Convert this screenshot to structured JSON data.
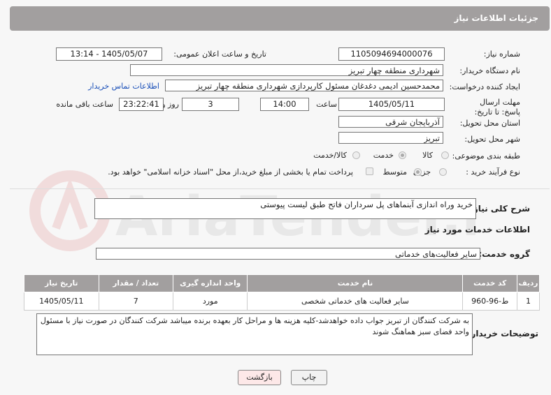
{
  "header": {
    "title": "جزئیات اطلاعات نیاز"
  },
  "fields": {
    "need_number_label": "شماره نیاز:",
    "need_number": "1105094694000076",
    "announce_label": "تاریخ و ساعت اعلان عمومی:",
    "announce_value": "1405/05/07 - 13:14",
    "buyer_org_label": "نام دستگاه خریدار:",
    "buyer_org": "شهرداری منطقه چهار تبریز",
    "requester_label": "ایجاد کننده درخواست:",
    "requester": "محمدحسین ادیمی دغدغان مسئول کارپردازی شهرداری منطقه چهار تبریز",
    "contact_link": "اطلاعات تماس خریدار",
    "deadline_label": "مهلت ارسال پاسخ: تا تاریخ:",
    "deadline_date": "1405/05/11",
    "time_label": "ساعت",
    "deadline_time": "14:00",
    "days_value": "3",
    "days_label": "روز و",
    "remaining_time": "23:22:41",
    "remaining_label": "ساعت باقی مانده",
    "province_label": "استان محل تحویل:",
    "province": "آذربایجان شرقی",
    "city_label": "شهر محل تحویل:",
    "city": "تبریز",
    "category_label": "طبقه بندی موضوعی:",
    "category_options": [
      "کالا",
      "خدمت",
      "کالا/خدمت"
    ],
    "process_label": "نوع فرآیند خرید :",
    "process_options": [
      "جزیی",
      "متوسط"
    ],
    "payment_note": "پرداخت تمام یا بخشی از مبلغ خرید،از محل \"اسناد خزانه اسلامی\" خواهد بود."
  },
  "summary": {
    "label": "شرح کلی نیاز:",
    "value": "خرید وراه اندازی آبنماهای پل سرداران فاتح طبق لیست پیوستی"
  },
  "services_section": {
    "title": "اطلاعات خدمات مورد نیاز",
    "group_label": "گروه خدمت:",
    "group_value": "سایر فعالیت‌های خدماتی"
  },
  "table": {
    "headers": [
      "ردیف",
      "کد خدمت",
      "نام خدمت",
      "واحد اندازه گیری",
      "تعداد / مقدار",
      "تاریخ نیاز"
    ],
    "rows": [
      [
        "1",
        "ط-96-960",
        "سایر فعالیت های خدماتی شخصی",
        "مورد",
        "7",
        "1405/05/11"
      ]
    ]
  },
  "buyer_notes": {
    "label": "توضیحات خریدار:",
    "value": "به شرکت کنندگان از تبریز جواب داده خواهدشد-کلیه هزینه ها و مراحل کار بعهده برنده میباشد شرکت کنندگان در صورت نیاز با مسئول واحد فضای سبز هماهنگ شوند"
  },
  "buttons": {
    "print": "چاپ",
    "back": "بازگشت"
  },
  "watermark": {
    "text": "AriaTender.net"
  },
  "colors": {
    "header_bg": "#a29f9f",
    "link": "#1a4fb8",
    "back_button_bg": "#fde8e8",
    "print_button_bg": "#f2f2f2"
  }
}
